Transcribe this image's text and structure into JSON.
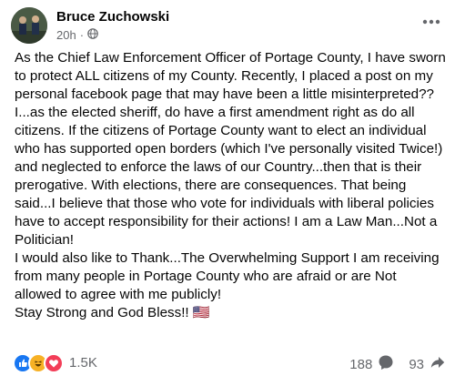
{
  "post": {
    "author": "Bruce Zuchowski",
    "time": "20h",
    "separator": "·",
    "paragraphs": [
      "As the Chief Law Enforcement Officer of Portage County, I have sworn to protect ALL citizens of my County. Recently, I placed a post on my personal facebook page that may have been a little misinterpreted??",
      "I...as the elected sheriff, do have a first amendment right as do all citizens. If the citizens of Portage County want to elect an individual who has supported open borders (which I've personally visited Twice!) and neglected to enforce the laws of our Country...then that is their prerogative. With elections, there are consequences. That being said...I believe that those who vote for individuals with liberal policies have to accept responsibility for their actions! I am a Law Man...Not a Politician!",
      "I would also like to Thank...The Overwhelming Support I am receiving from many people in Portage County who are afraid or are Not allowed to agree with me publicly!",
      " Stay Strong and God Bless!! 🇺🇸"
    ]
  },
  "stats": {
    "reactions_count": "1.5K",
    "comments_count": "188",
    "shares_count": "93"
  },
  "icons": {
    "audience": "globe-icon",
    "more": "more-options-icon",
    "reactions": [
      "like-icon",
      "haha-icon",
      "love-icon"
    ],
    "comment": "comment-icon",
    "share": "share-icon"
  },
  "colors": {
    "like": "#1877f2",
    "love": "#f33e58",
    "haha": "#f7b125",
    "secondary_text": "#65676b"
  }
}
